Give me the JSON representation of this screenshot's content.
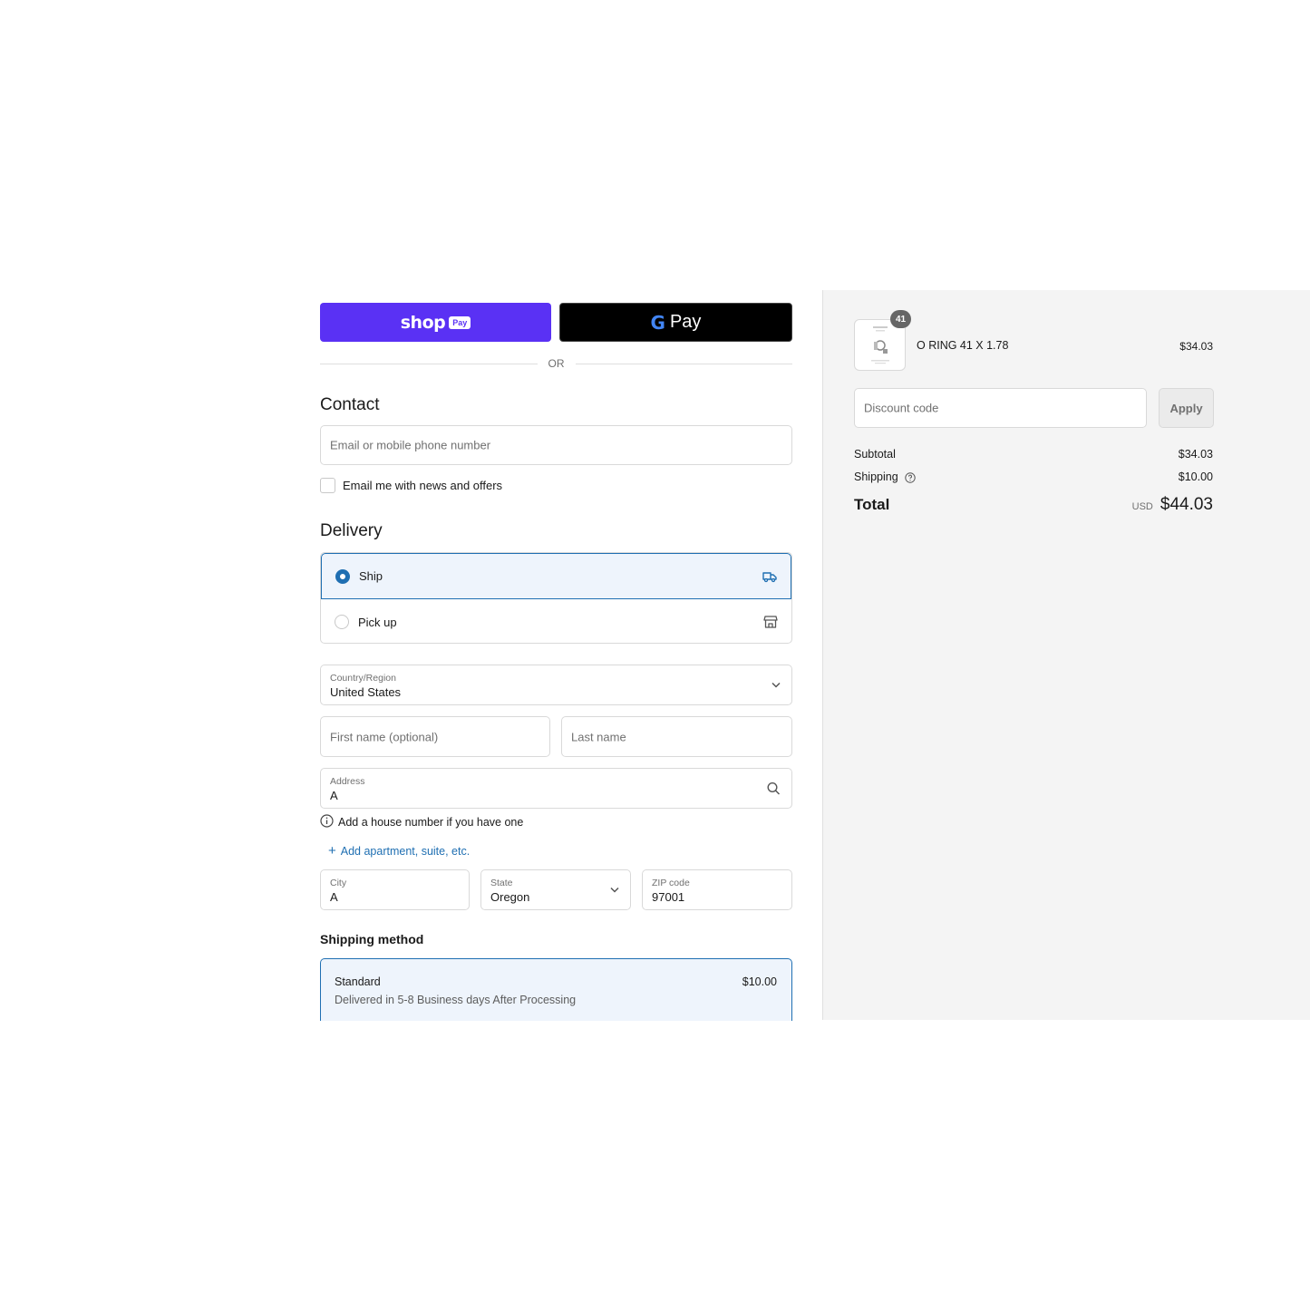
{
  "express": {
    "shop_pay_word": "shop",
    "shop_pay_badge": "Pay",
    "gpay_letter": "G",
    "gpay_word": "Pay",
    "or_text": "OR"
  },
  "contact": {
    "title": "Contact",
    "email_placeholder": "Email or mobile phone number",
    "newsletter_label": "Email me with news and offers"
  },
  "delivery": {
    "title": "Delivery",
    "options": [
      {
        "label": "Ship",
        "selected": true,
        "icon": "truck-icon"
      },
      {
        "label": "Pick up",
        "selected": false,
        "icon": "store-icon"
      }
    ],
    "country_label": "Country/Region",
    "country_value": "United States",
    "first_name_placeholder": "First name (optional)",
    "last_name_placeholder": "Last name",
    "address_label": "Address",
    "address_value": "A",
    "address_hint": "Add a house number if you have one",
    "add_apartment": "Add apartment, suite, etc.",
    "city_label": "City",
    "city_value": "A",
    "state_label": "State",
    "state_value": "Oregon",
    "zip_label": "ZIP code",
    "zip_value": "97001"
  },
  "shipping_method": {
    "title": "Shipping method",
    "name": "Standard",
    "description": "Delivered in 5-8 Business days After Processing",
    "price": "$10.00"
  },
  "summary": {
    "product": {
      "name": "O RING 41 X 1.78",
      "price": "$34.03",
      "quantity": "41"
    },
    "discount_placeholder": "Discount code",
    "apply_label": "Apply",
    "subtotal_label": "Subtotal",
    "subtotal_value": "$34.03",
    "shipping_label": "Shipping",
    "shipping_value": "$10.00",
    "total_label": "Total",
    "currency": "USD",
    "total_value": "$44.03"
  },
  "colors": {
    "shop_pay": "#5a31f4",
    "accent": "#1f6fb2",
    "selected_bg": "#eef4fc",
    "summary_bg": "#f4f4f4"
  }
}
